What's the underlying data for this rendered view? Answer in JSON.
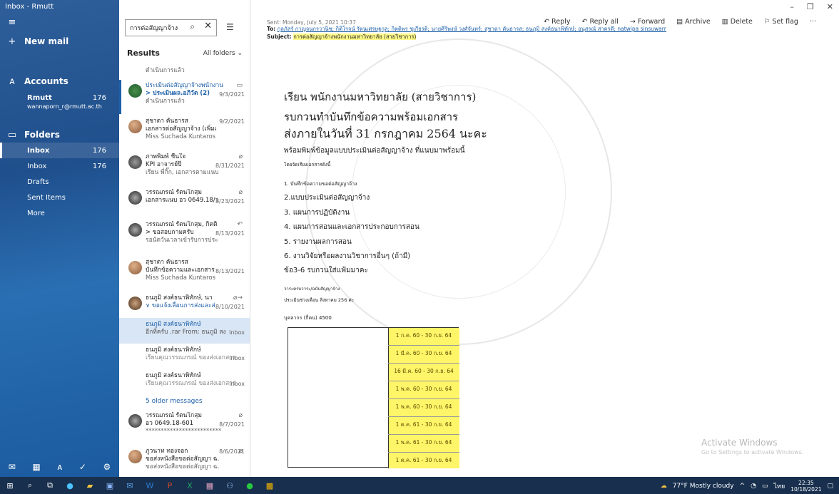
{
  "window_title": "Inbox - Rmutt",
  "nav": {
    "new_mail": "New mail",
    "accounts": "Accounts",
    "account_name": "Rmutt",
    "account_email": "wannaporn_r@rmutt.ac.th",
    "account_count": "176",
    "folders": "Folders",
    "items": [
      {
        "label": "Inbox",
        "count": "176"
      },
      {
        "label": "Inbox",
        "count": "176"
      },
      {
        "label": "Drafts",
        "count": ""
      },
      {
        "label": "Sent Items",
        "count": ""
      },
      {
        "label": "More",
        "count": ""
      }
    ]
  },
  "search": {
    "value": "การต่อสัญญาจ้าง"
  },
  "list": {
    "results": "Results",
    "all_folders": "All folders",
    "older": "5 older messages",
    "messages": [
      {
        "l1": "ดำเนินการแล้ว",
        "l2": "",
        "l3": "",
        "date": "",
        "top": "top"
      },
      {
        "l1": "ประเมินต่อสัญญาจ้างพนักงาน",
        "l2": "> ประเมินผล.อภิวัต (2)",
        "l3": "ดำเนินการแล้ว",
        "date": "9/3/2021"
      },
      {
        "l1": "สุชาดา คันธารส",
        "l2": "เอกสารต่อสัญญาจ้าง (เพิ่มเ",
        "l3": "Miss Suchada Kuntaros",
        "date": "9/2/2021"
      },
      {
        "l1": "ภาพพิมพ์ ชื่นใจ",
        "l2": "KPI อาจารย์ปี",
        "l3": "เรียน พี่กิ๊ก, เอกสารตามแนบ",
        "date": "8/31/2021"
      },
      {
        "l1": "วรรณภรณ์ รัตนโกสุม",
        "l2": "เอกสารแนบ อว 0649.18/ว",
        "l3": "",
        "date": "8/23/2021"
      },
      {
        "l1": "วรรณภรณ์ รัตนโกสุม, กิตติ",
        "l2": "> ขอสอบถามครับ",
        "l3": "รอนัดวันเวลาเข้ารับการประ",
        "date": "8/13/2021"
      },
      {
        "l1": "สุชาดา คันธารส",
        "l2": "บันทึกข้อความและเอกสาร",
        "l3": "Miss Suchada Kuntaros",
        "date": "8/13/2021"
      },
      {
        "l1": "ธนภูมิ สงค์ธนาพิทักษ์, นา",
        "l2": "∨ ขอแจ้งเลื่อนการส่งและส่",
        "l3": "",
        "date": "8/10/2021"
      },
      {
        "l1": "ธนภูมิ สงค์ธนาพิทักษ์",
        "l2": "อีกที่ครับ .rar From: ธนภูมิ สง",
        "l3": "",
        "date": "Inbox"
      },
      {
        "l1": "ธนภูมิ สงค์ธนาพิทักษ์",
        "l2": "เรียนคุณวรรณภรณ์ ของส่งเอกสาร",
        "l3": "",
        "date": "Inbox"
      },
      {
        "l1": "ธนภูมิ สงค์ธนาพิทักษ์",
        "l2": "เรียนคุณวรรณภรณ์ ของส่งเอกสาร",
        "l3": "",
        "date": "Inbox"
      },
      {
        "l1": "วรรณภรณ์ รัตนโกสุม",
        "l2": "อว 0649.18-601",
        "l3": "*************************",
        "date": "8/7/2021"
      },
      {
        "l1": "ภูวนาท ทองจอก",
        "l2": "ขอส่งหนังสือขอต่อสัญญา ฉ.",
        "l3": "ขอส่งหนังสือขอต่อสัญญา ฉ.",
        "date": "8/6/2021"
      }
    ]
  },
  "toolbar": {
    "reply": "Reply",
    "reply_all": "Reply all",
    "forward": "Forward",
    "archive": "Archive",
    "delete": "Delete",
    "set_flag": "Set flag",
    "more": "···"
  },
  "header": {
    "sent": "Sent: Monday, July 5, 2021 10:37",
    "to_label": "To:",
    "to": "กุลภัสร์ กาญจนกรวานิช; กิติโรจน์ รัตนเศรษฐกุล; กิตติพร ชูเกียรติ; นายศิริพงษ์ วงศ์จันทร์; สุชาดา คันธารส; ธนภูมิ สงค์ธนาพิทักษ์; อนุสรณ์ สาครดี; natwipa sinsuwarn",
    "subject_label": "Subject:",
    "subject": "การต่อสัญญาจ้างพนักงานมหาวิทยาลัย (สายวิชาการ)"
  },
  "body": {
    "line1": "เรียน พนักงานมหาวิทยาลัย (สายวิชาการ)",
    "line2": "รบกวนทำบันทึกข้อความพร้อมเอกสาร",
    "line3": "ส่งภายในวันที่ 31 กรกฎาคม 2564 นะคะ",
    "line4": "พร้อมพิมพ์ข้อมูลแบบประเมินต่อสัญญาจ้าง ที่แนบมาพร้อมนี้",
    "small": "โดยจัดเรียงเอกสารดังนี้",
    "items": [
      "1. บันทึกข้อความขอต่อสัญญาจ้าง",
      "2.แบบประเมินต่อสัญญาจ้าง",
      "3. แผนการปฏิบัติงาน",
      "4. แผนการสอนและเอกสารประกอบการสอน",
      "5. รายงานผลการสอน",
      "6. งานวิจัยหรือผลงานวิชาการอื่นๆ (ถ้ามี)",
      "ข้อ3-6 รบกวนใส่แฟ้มมาคะ"
    ],
    "note1": "วาระครบวาระ/ฉบับสัญญาจ้าง",
    "note2": "ประเมินช่วงเดือน สิงหาคม 256 ค่ะ",
    "budget": "บุคลากร (กี่คน) 4500",
    "table": [
      "1 ก.ค. 60 - 30 ก.ย. 64",
      "1 มี.ค. 60 - 30 ก.ย. 64",
      "16 มี.ค. 60 - 30 ก.ย. 64",
      "1 พ.ค. 60 - 30 ก.ย. 64",
      "1 พ.ค. 60 - 30 ก.ย. 64",
      "1 ต.ค. 61 - 30 ก.ย. 64",
      "1 พ.ค. 61 - 30 ก.ย. 64",
      "1 ต.ค. 61 - 30 ก.ย. 64"
    ]
  },
  "activate": {
    "title": "Activate Windows",
    "sub": "Go to Settings to activate Windows."
  },
  "tray": {
    "weather": "77°F Mostly cloudy",
    "time": "22:35",
    "date": "10/18/2021",
    "lang": "ไทย"
  }
}
